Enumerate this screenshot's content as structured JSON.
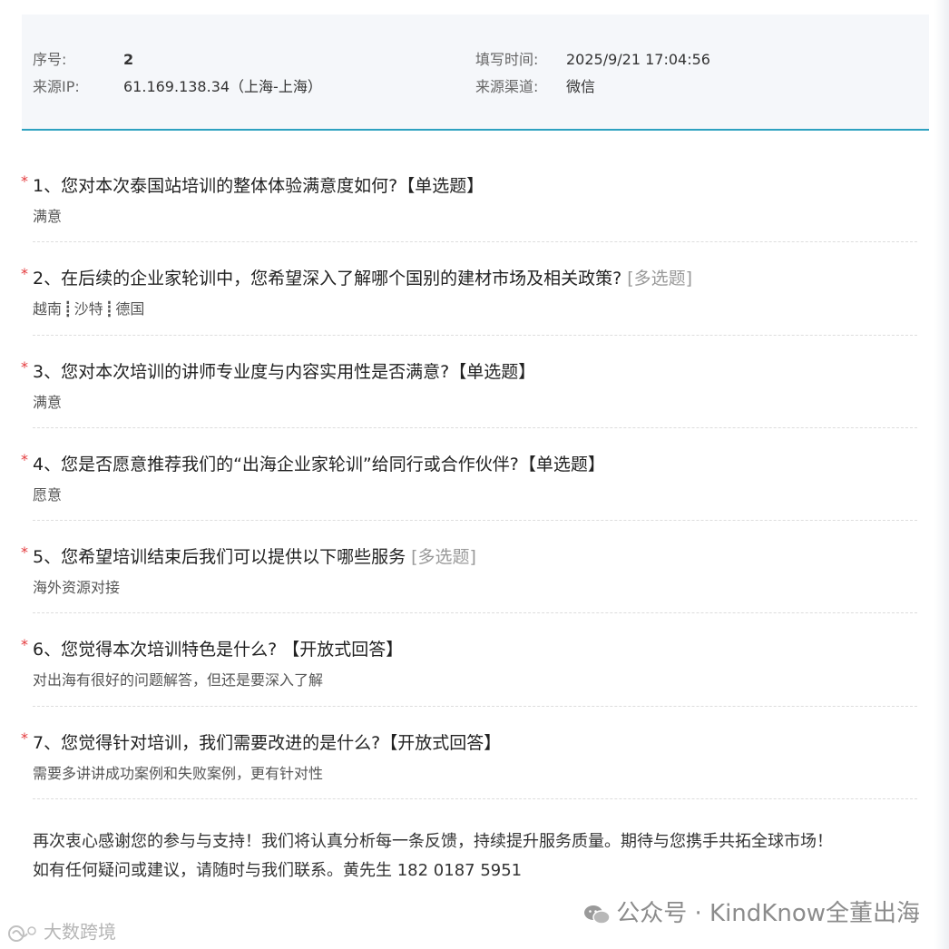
{
  "header": {
    "seq_label": "序号:",
    "seq_value": "2",
    "ip_label": "来源IP:",
    "ip_value": "61.169.138.34（上海-上海）",
    "time_label": "填写时间:",
    "time_value": "2025/9/21 17:04:56",
    "channel_label": "来源渠道:",
    "channel_value": "微信"
  },
  "required_mark": "*",
  "questions": [
    {
      "title": "1、您对本次泰国站培训的整体体验满意度如何?",
      "type": "【单选题】",
      "answer": "满意"
    },
    {
      "title": "2、在后续的企业家轮训中，您希望深入了解哪个国别的建材市场及相关政策?",
      "type": "[多选题]",
      "answers": [
        "越南",
        "沙特",
        "德国"
      ],
      "separator": "┋"
    },
    {
      "title": "3、您对本次培训的讲师专业度与内容实用性是否满意?",
      "type": "【单选题】",
      "answer": "满意"
    },
    {
      "title": "4、您是否愿意推荐我们的“出海企业家轮训”给同行或合作伙伴?",
      "type": "【单选题】",
      "answer": "愿意"
    },
    {
      "title": "5、您希望培训结束后我们可以提供以下哪些服务",
      "type": "[多选题]",
      "answer": "海外资源对接"
    },
    {
      "title": "6、您觉得本次培训特色是什么? ",
      "type": "【开放式回答】",
      "answer": "对出海有很好的问题解答，但还是要深入了解"
    },
    {
      "title": "7、您觉得针对培训，我们需要改进的是什么?",
      "type": "【开放式回答】",
      "answer": "需要多讲讲成功案例和失败案例，更有针对性"
    }
  ],
  "closing": {
    "line1": "再次衷心感谢您的参与与支持！我们将认真分析每一条反馈，持续提升服务质量。期待与您携手共拓全球市场！",
    "line2": "如有任何疑问或建议，请随时与我们联系。黄先生 182 0187 5951"
  },
  "watermarks": {
    "right": "公众号 · KindKnow全董出海",
    "left": "大数跨境"
  },
  "colors": {
    "accent": "#2da1c0",
    "required": "#e4393c"
  }
}
